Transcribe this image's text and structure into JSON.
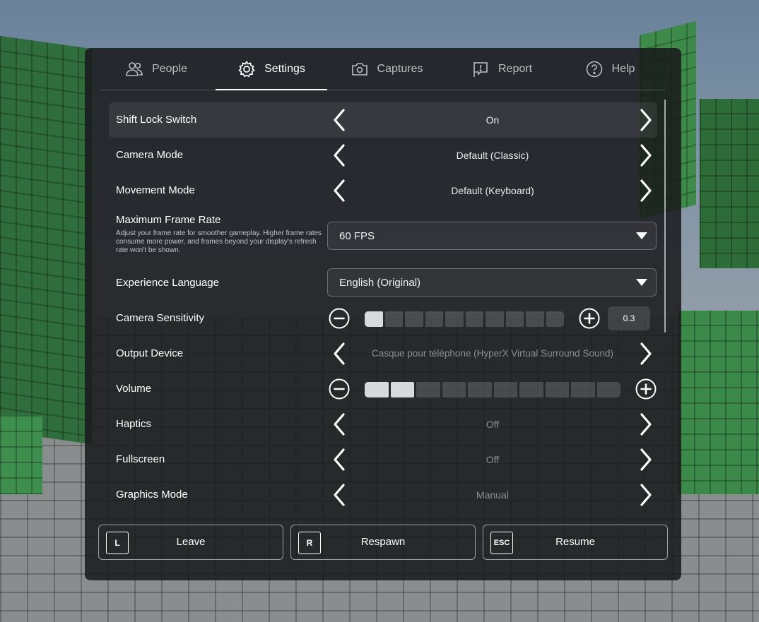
{
  "tabs": [
    {
      "label": "People",
      "icon": "people-icon"
    },
    {
      "label": "Settings",
      "icon": "gear-icon"
    },
    {
      "label": "Captures",
      "icon": "camera-icon"
    },
    {
      "label": "Report",
      "icon": "flag-icon"
    },
    {
      "label": "Help",
      "icon": "help-icon"
    }
  ],
  "active_tab": "Settings",
  "settings": {
    "shift_lock": {
      "label": "Shift Lock Switch",
      "value": "On"
    },
    "camera_mode": {
      "label": "Camera Mode",
      "value": "Default (Classic)"
    },
    "movement_mode": {
      "label": "Movement Mode",
      "value": "Default (Keyboard)"
    },
    "frame_rate": {
      "label": "Maximum Frame Rate",
      "description": "Adjust your frame rate for smoother gameplay. Higher frame rates consume more power, and frames beyond your display's refresh rate won't be shown.",
      "value": "60 FPS"
    },
    "language": {
      "label": "Experience Language",
      "value": "English (Original)"
    },
    "camera_sensitivity": {
      "label": "Camera Sensitivity",
      "value": "0.3",
      "filled_segments": 1,
      "total_segments": 10
    },
    "output_device": {
      "label": "Output Device",
      "value": "Casque pour téléphone (HyperX Virtual Surround Sound)"
    },
    "volume": {
      "label": "Volume",
      "filled_segments": 2,
      "total_segments": 10
    },
    "haptics": {
      "label": "Haptics",
      "value": "Off"
    },
    "fullscreen": {
      "label": "Fullscreen",
      "value": "Off"
    },
    "graphics_mode": {
      "label": "Graphics Mode",
      "value": "Manual"
    }
  },
  "actions": [
    {
      "key": "L",
      "label": "Leave"
    },
    {
      "key": "R",
      "label": "Respawn"
    },
    {
      "key": "ESC",
      "label": "Resume"
    }
  ],
  "colors": {
    "panel": "#18191b",
    "segment_on": "#d8d9da",
    "text_dim": "#8d8e90"
  }
}
